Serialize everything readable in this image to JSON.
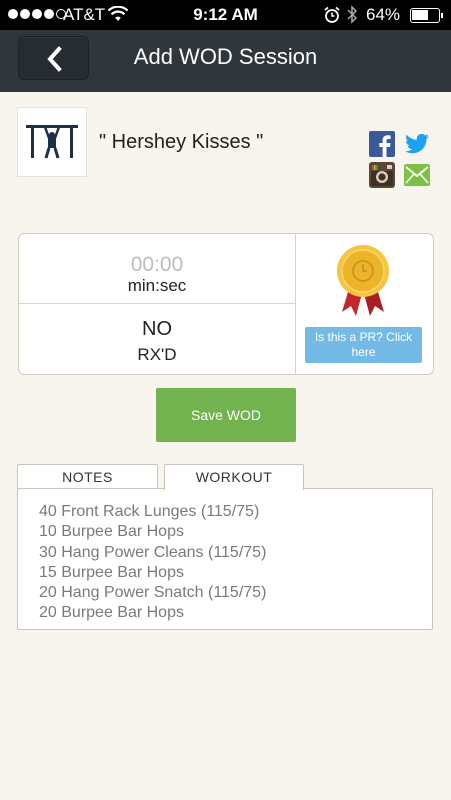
{
  "status_bar": {
    "carrier": "AT&T",
    "time": "9:12 AM",
    "battery_percent": "64%",
    "battery_level": 0.64,
    "signal_bars": 4
  },
  "nav": {
    "title": "Add WOD Session",
    "back_icon": "chevron-left-icon"
  },
  "wod": {
    "name": "\" Hershey Kisses \""
  },
  "social": {
    "facebook_color": "#3b5998",
    "twitter_color": "#1da1f2",
    "instagram_color": "#5a4634",
    "email_color": "#7ac144"
  },
  "score": {
    "time_value": "00:00",
    "time_unit": "min:sec",
    "rx_value": "NO",
    "rx_label": "RX'D",
    "pr_button_label": "Is this a PR? Click here"
  },
  "save_label": "Save WOD",
  "tabs": [
    {
      "label": "NOTES",
      "active": false
    },
    {
      "label": "WORKOUT",
      "active": true
    }
  ],
  "workout": {
    "lines": [
      "40 Front Rack Lunges (115/75)",
      "10 Burpee Bar Hops",
      "30 Hang Power Cleans (115/75)",
      "15 Burpee Bar Hops",
      "20 Hang Power Snatch (115/75)",
      "20 Burpee Bar Hops"
    ]
  },
  "colors": {
    "nav_bg": "#2f363c",
    "save_green": "#72b34f",
    "pr_blue": "#73bbe6",
    "page_bg": "#f8f4ee"
  }
}
